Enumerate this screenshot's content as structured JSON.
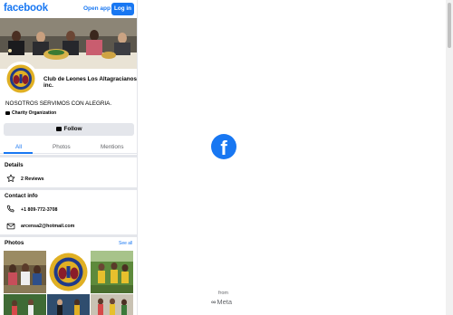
{
  "header": {
    "logo_text": "facebook",
    "open_app_label": "Open app",
    "login_label": "Log in"
  },
  "profile": {
    "name": "Club de Leones Los Altagracianos inc.",
    "motto": "NOSOTROS SERVIMOS CON ALEGRIA.",
    "category": "Charity Organization",
    "follow_label": "Follow"
  },
  "tabs": [
    {
      "label": "All",
      "active": true
    },
    {
      "label": "Photos",
      "active": false
    },
    {
      "label": "Mentions",
      "active": false
    }
  ],
  "details": {
    "title": "Details",
    "reviews": "2 Reviews"
  },
  "contact": {
    "title": "Contact info",
    "phone": "+1 809-772-3708",
    "email": "arcensa2@hotmail.com"
  },
  "photos": {
    "title": "Photos",
    "see_all": "See all"
  },
  "footer": {
    "from": "from",
    "meta": "Meta"
  },
  "colors": {
    "brand_blue": "#1877f2",
    "button_gray": "#e4e6eb",
    "secondary_text": "#65676b"
  },
  "icons": {
    "star": "star-icon",
    "phone": "phone-icon",
    "mail": "mail-icon",
    "follow": "follow-icon",
    "category": "category-icon"
  }
}
